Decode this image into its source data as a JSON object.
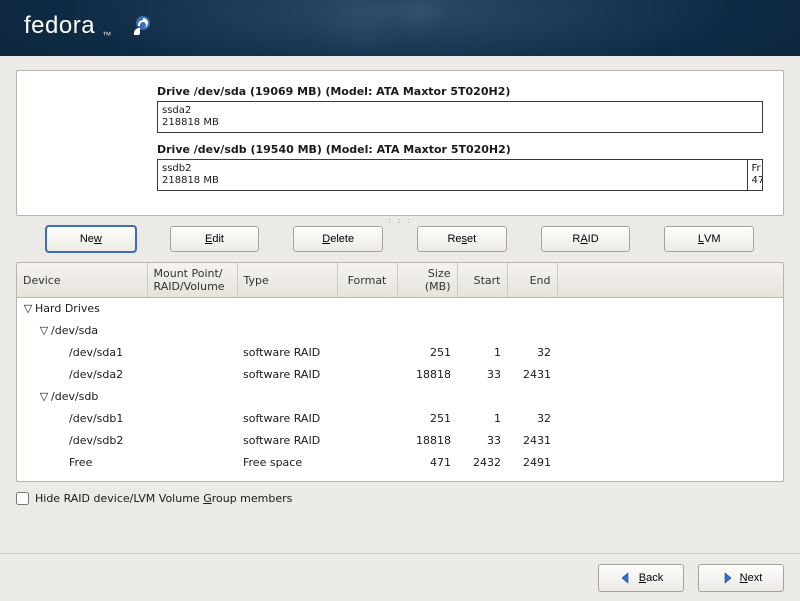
{
  "brand": {
    "name": "fedora",
    "tm": "™"
  },
  "drives": [
    {
      "title": "Drive /dev/sda (19069 MB) (Model: ATA Maxtor 5T020H2)",
      "segments": [
        {
          "label": "ssda2",
          "size": "218818 MB",
          "width_pct": 100
        }
      ]
    },
    {
      "title": "Drive /dev/sdb (19540 MB) (Model: ATA Maxtor 5T020H2)",
      "segments": [
        {
          "label": "ssdb2",
          "size": "218818 MB",
          "width_pct": 97.6
        },
        {
          "label": "Fr",
          "size": "47",
          "width_pct": 2.4
        }
      ]
    }
  ],
  "buttons": {
    "new": {
      "pre": "Ne",
      "ul": "w",
      "post": ""
    },
    "edit": {
      "pre": "",
      "ul": "E",
      "post": "dit"
    },
    "delete": {
      "pre": "",
      "ul": "D",
      "post": "elete"
    },
    "reset": {
      "pre": "Re",
      "ul": "s",
      "post": "et"
    },
    "raid": {
      "pre": "R",
      "ul": "A",
      "post": "ID"
    },
    "lvm": {
      "pre": "",
      "ul": "L",
      "post": "VM"
    }
  },
  "columns": {
    "device": "Device",
    "mount": "Mount Point/\nRAID/Volume",
    "type": "Type",
    "format": "Format",
    "size": "Size\n(MB)",
    "start": "Start",
    "end": "End"
  },
  "rows": [
    {
      "indent": 0,
      "expander": "▽",
      "device": "Hard Drives"
    },
    {
      "indent": 1,
      "expander": "▽",
      "device": "/dev/sda"
    },
    {
      "indent": 2,
      "device": "/dev/sda1",
      "type": "software RAID",
      "size": "251",
      "start": "1",
      "end": "32"
    },
    {
      "indent": 2,
      "device": "/dev/sda2",
      "type": "software RAID",
      "size": "18818",
      "start": "33",
      "end": "2431"
    },
    {
      "indent": 1,
      "expander": "▽",
      "device": "/dev/sdb"
    },
    {
      "indent": 2,
      "device": "/dev/sdb1",
      "type": "software RAID",
      "size": "251",
      "start": "1",
      "end": "32"
    },
    {
      "indent": 2,
      "device": "/dev/sdb2",
      "type": "software RAID",
      "size": "18818",
      "start": "33",
      "end": "2431"
    },
    {
      "indent": 2,
      "device": "Free",
      "type": "Free space",
      "size": "471",
      "start": "2432",
      "end": "2491"
    }
  ],
  "checkbox": {
    "pre": "Hide RAID device/LVM Volume ",
    "ul": "G",
    "post": "roup members",
    "checked": false
  },
  "nav": {
    "back": {
      "ul": "B",
      "post": "ack"
    },
    "next": {
      "ul": "N",
      "post": "ext"
    }
  },
  "colors": {
    "accent": "#3e6db5",
    "arrow_back": "#2e6fd6",
    "arrow_next": "#2e6fd6"
  }
}
